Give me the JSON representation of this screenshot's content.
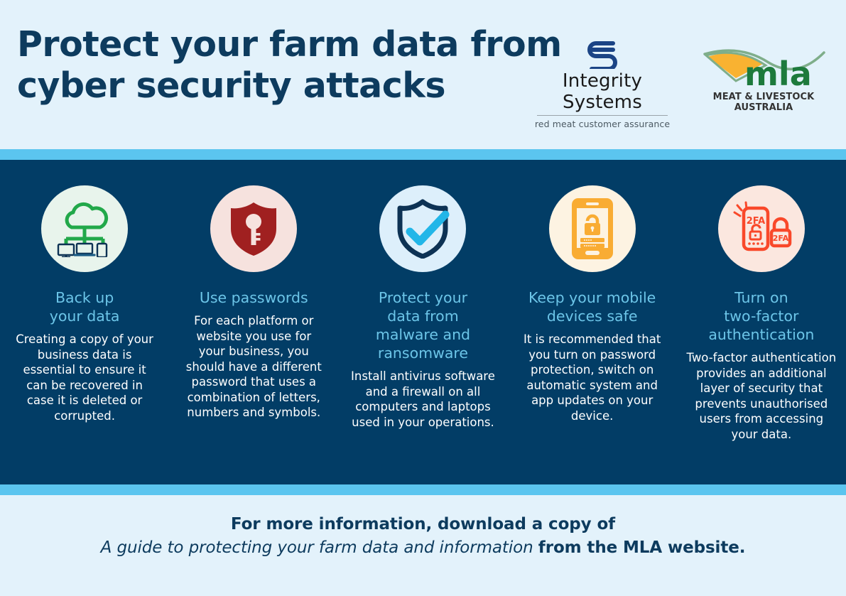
{
  "header": {
    "title_line1": "Protect your farm data from",
    "title_line2": "cyber security attacks",
    "integrity_systems": {
      "mark": "integrity-systems-s-mark",
      "name": "Integrity Systems",
      "tagline": "red meat customer assurance"
    },
    "mla": {
      "wordmark": "mla",
      "subtitle": "MEAT & LIVESTOCK AUSTRALIA"
    }
  },
  "colors": {
    "page_bg": "#e3f2fb",
    "band_navy": "#023d66",
    "stripe_blue": "#5bc5ef",
    "heading_navy": "#0d3b5e",
    "col_heading": "#6cc5e8",
    "col_body": "#ffffff",
    "icon_green": "#22a84a",
    "icon_dark_red": "#a02020",
    "icon_navy": "#0d3254",
    "icon_cyan": "#22b6e8",
    "icon_amber": "#f9ac33",
    "icon_orange_red": "#f9482a",
    "mla_green": "#1d7a3c",
    "mla_orange": "#f9b231"
  },
  "columns": [
    {
      "icon": "cloud-backup-devices-icon",
      "circle_color": "#e8f4ec",
      "heading": "Back up\nyour data",
      "heading_lines": [
        "Back up",
        "your data"
      ],
      "body": "Creating a copy of your business data is essential to ensure it can be recovered in case it is deleted or corrupted."
    },
    {
      "icon": "shield-key-icon",
      "circle_color": "#f6e2de",
      "heading": "Use passwords",
      "heading_lines": [
        "Use passwords"
      ],
      "body": "For each platform or website you use for your business, you should have a different password that uses a combination of letters, numbers and symbols."
    },
    {
      "icon": "shield-check-icon",
      "circle_color": "#ddeffb",
      "heading": "Protect your data from malware and ransomware",
      "heading_lines": [
        "Protect your",
        "data from",
        "malware and",
        "ransomware"
      ],
      "body": "Install antivirus software and a firewall on all computers and laptops used in your operations."
    },
    {
      "icon": "mobile-phone-lock-icon",
      "circle_color": "#fdf3e2",
      "heading": "Keep your mobile devices safe",
      "heading_lines": [
        "Keep your mobile",
        "devices safe"
      ],
      "body": "It is recommended that you turn on password protection, switch on automatic system and app updates on your device."
    },
    {
      "icon": "two-factor-auth-icon",
      "circle_color": "#fbe7df",
      "heading": "Turn on two-factor authentication",
      "heading_lines": [
        "Turn on",
        "two-factor",
        "authentication"
      ],
      "body": "Two-factor authentication provides an additional layer of security that prevents unauthorised users from accessing your data."
    }
  ],
  "footer": {
    "line1": "For more information, download a copy of",
    "line2_italic": "A guide to protecting your farm data and information",
    "line2_bold": "from the MLA website."
  }
}
